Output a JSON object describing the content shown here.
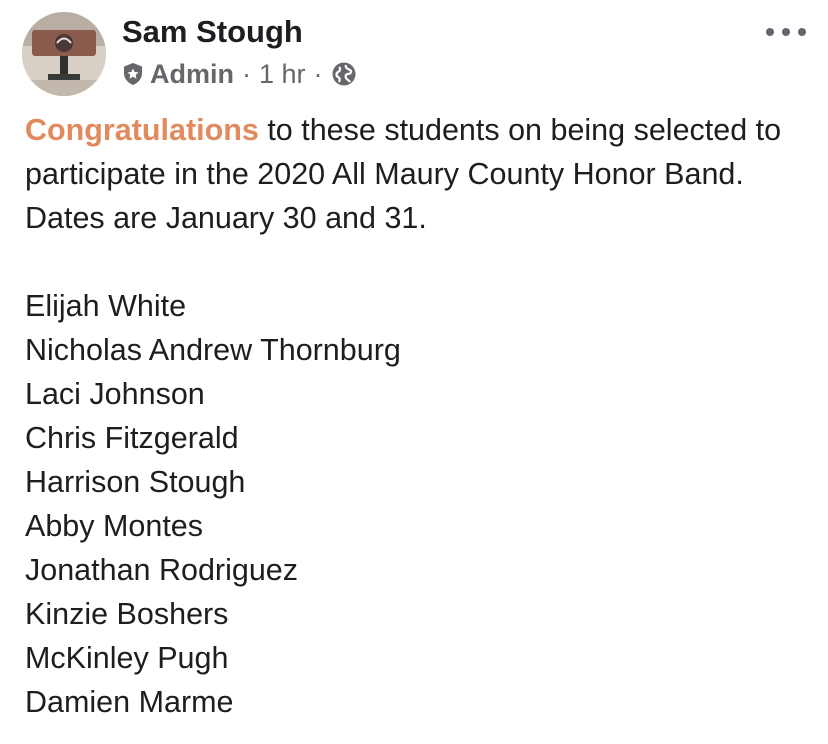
{
  "post": {
    "author": "Sam Stough",
    "role": "Admin",
    "separator": "·",
    "time": "1 hr",
    "icons": {
      "role": "shield-icon",
      "privacy": "globe-icon",
      "menu": "more-options-icon"
    },
    "highlight": "Congratulations",
    "text_rest": " to these students on being selected to participate in the 2020 All Maury County Honor Band. Dates are January 30 and 31.",
    "names": [
      "Elijah White",
      "Nicholas Andrew Thornburg",
      "Laci Johnson",
      "Chris Fitzgerald",
      "Harrison Stough",
      "Abby Montes",
      "Jonathan Rodriguez",
      "Kinzie Boshers",
      "McKinley Pugh",
      "Damien Marme"
    ]
  },
  "colors": {
    "highlight": "#e28a5d",
    "text": "#1c1e21",
    "meta": "#65676b"
  }
}
